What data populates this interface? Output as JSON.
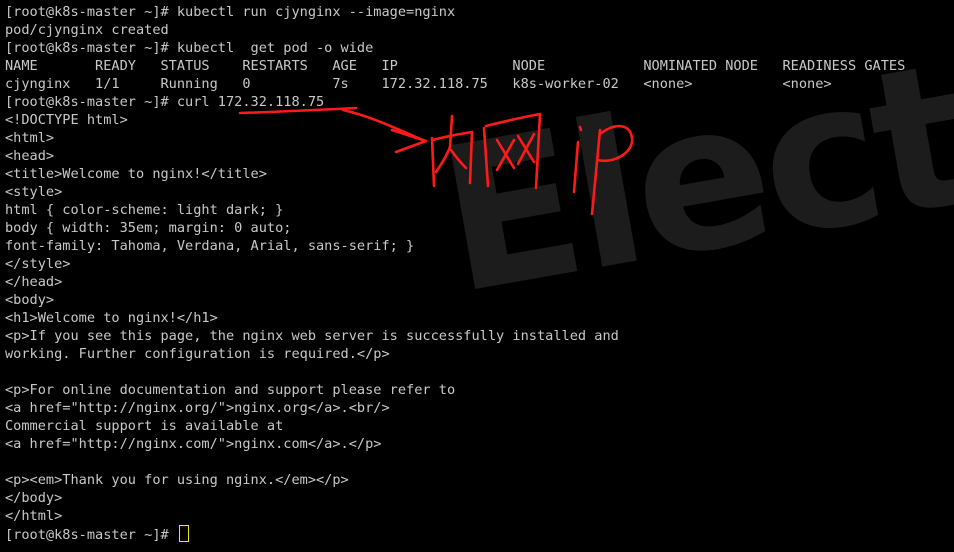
{
  "watermark": "Electe",
  "annotation_text": "内网ip",
  "colors": {
    "background": "#000000",
    "text": "#c8c8c8",
    "annotation": "#ff1a1a",
    "cursor": "#e8e800"
  },
  "lines": [
    "[root@k8s-master ~]# kubectl run cjynginx --image=nginx",
    "pod/cjynginx created",
    "[root@k8s-master ~]# kubectl  get pod -o wide",
    "NAME       READY   STATUS    RESTARTS   AGE   IP              NODE            NOMINATED NODE   READINESS GATES",
    "cjynginx   1/1     Running   0          7s    172.32.118.75   k8s-worker-02   <none>           <none>",
    "[root@k8s-master ~]# curl 172.32.118.75",
    "<!DOCTYPE html>",
    "<html>",
    "<head>",
    "<title>Welcome to nginx!</title>",
    "<style>",
    "html { color-scheme: light dark; }",
    "body { width: 35em; margin: 0 auto;",
    "font-family: Tahoma, Verdana, Arial, sans-serif; }",
    "</style>",
    "</head>",
    "<body>",
    "<h1>Welcome to nginx!</h1>",
    "<p>If you see this page, the nginx web server is successfully installed and",
    "working. Further configuration is required.</p>",
    "",
    "<p>For online documentation and support please refer to",
    "<a href=\"http://nginx.org/\">nginx.org</a>.<br/>",
    "Commercial support is available at",
    "<a href=\"http://nginx.com/\">nginx.com</a>.</p>",
    "",
    "<p><em>Thank you for using nginx.</em></p>",
    "</body>",
    "</html>",
    "[root@k8s-master ~]# "
  ]
}
